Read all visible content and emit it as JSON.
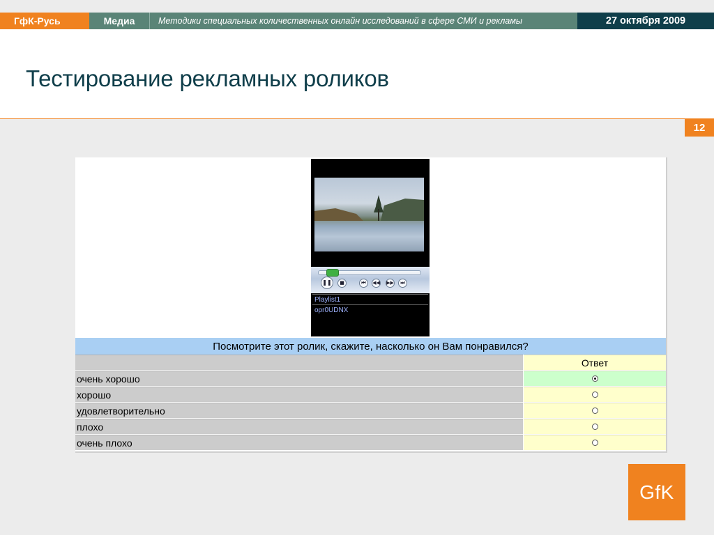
{
  "header": {
    "brand": "ГфК-Русь",
    "section": "Медиа",
    "description": "Методики специальных количественных онлайн исследований в сфере СМИ и рекламы",
    "date": "27 октября 2009"
  },
  "slide": {
    "title": "Тестирование рекламных роликов",
    "page_number": "12"
  },
  "player": {
    "playlist": [
      "Playlist1",
      "opr0UDNX"
    ],
    "progress": 0.08,
    "controls": [
      "pause-icon",
      "stop-icon",
      "previous-icon",
      "rewind-icon",
      "fast-forward-icon",
      "next-icon"
    ]
  },
  "survey": {
    "question": "Посмотрите этот ролик, скажите, насколько он Вам понравился?",
    "answer_header": "Ответ",
    "options": [
      {
        "label": "очень хорошо",
        "selected": true
      },
      {
        "label": "хорошо",
        "selected": false
      },
      {
        "label": "удовлетворительно",
        "selected": false
      },
      {
        "label": "плохо",
        "selected": false
      },
      {
        "label": "очень плохо",
        "selected": false
      }
    ]
  },
  "logo": {
    "text": "GfK"
  },
  "colors": {
    "brand_orange": "#f0821f",
    "header_green": "#5a8477",
    "date_navy": "#0f3e4a",
    "question_blue": "#a9cff3",
    "answer_yellow": "#ffffcc",
    "selected_green": "#ccffcc"
  }
}
